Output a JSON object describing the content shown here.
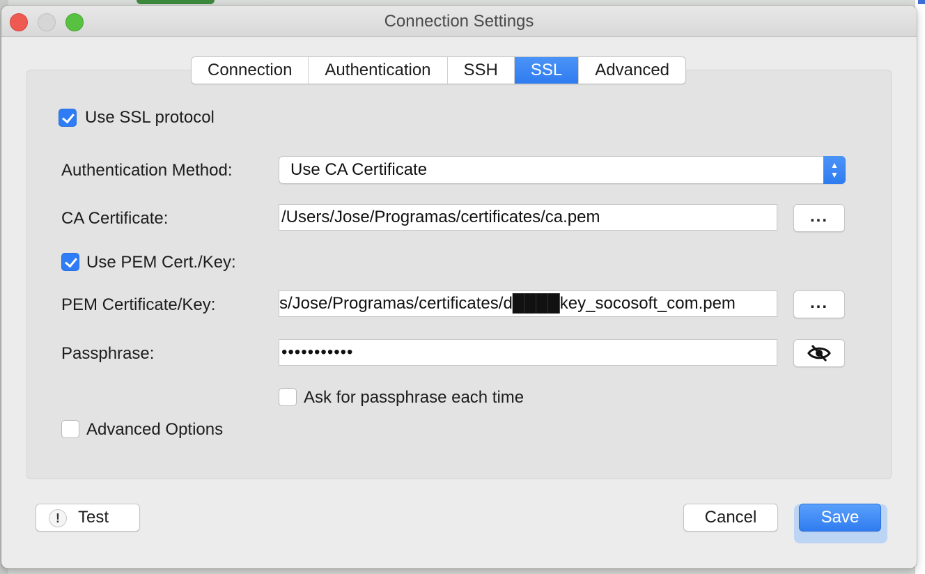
{
  "window": {
    "title": "Connection Settings"
  },
  "tabs": [
    {
      "label": "Connection",
      "active": false
    },
    {
      "label": "Authentication",
      "active": false
    },
    {
      "label": "SSH",
      "active": false
    },
    {
      "label": "SSL",
      "active": true
    },
    {
      "label": "Advanced",
      "active": false
    }
  ],
  "ssl": {
    "use_ssl": {
      "label": "Use SSL protocol",
      "checked": true
    },
    "auth_method": {
      "label": "Authentication Method:",
      "value": "Use CA Certificate"
    },
    "ca_cert": {
      "label": "CA Certificate:",
      "value": "/Users/Jose/Programas/certificates/ca.pem",
      "browse_label": "..."
    },
    "use_pem": {
      "label": "Use PEM Cert./Key:",
      "checked": true
    },
    "pem_cert": {
      "label": "PEM Certificate/Key:",
      "value": "s/Jose/Programas/certificates/d████key_socosoft_com.pem",
      "browse_label": "..."
    },
    "passphrase": {
      "label": "Passphrase:",
      "value": "•••••••••••"
    },
    "ask_passphrase": {
      "label": "Ask for passphrase each time",
      "checked": false
    },
    "advanced_options": {
      "label": "Advanced Options",
      "checked": false
    }
  },
  "footer": {
    "test_label": "Test",
    "cancel_label": "Cancel",
    "save_label": "Save"
  },
  "colors": {
    "accent": "#2f7cf0",
    "close": "#ee5a52",
    "maximize": "#58c141"
  }
}
